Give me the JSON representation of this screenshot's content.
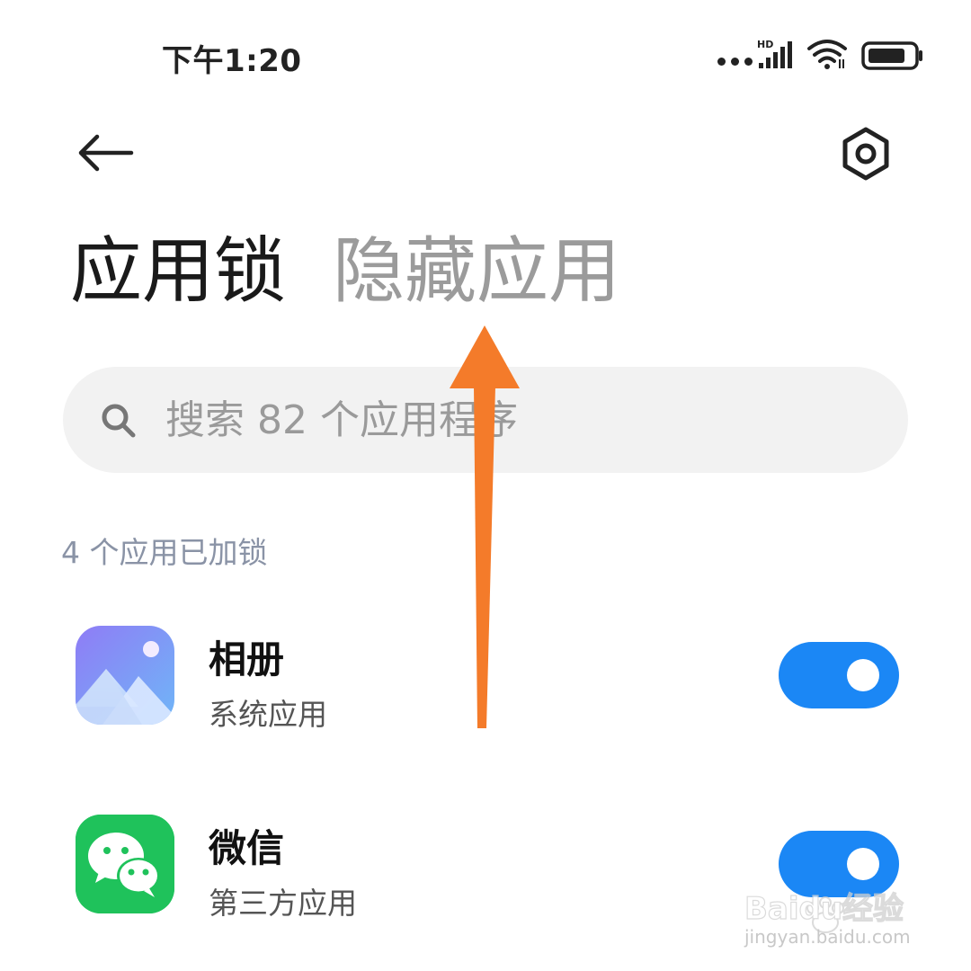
{
  "status_bar": {
    "time": "下午1:20",
    "signal_label": "HD",
    "icons": [
      "more-dots-icon",
      "signal-icon",
      "wifi-icon",
      "battery-icon"
    ]
  },
  "header": {
    "back_icon": "back-arrow-icon",
    "settings_icon": "settings-hex-icon"
  },
  "tabs": [
    {
      "label": "应用锁",
      "active": true
    },
    {
      "label": "隐藏应用",
      "active": false
    }
  ],
  "search": {
    "placeholder": "搜索 82 个应用程序",
    "value": ""
  },
  "section": {
    "title": "4 个应用已加锁"
  },
  "apps": [
    {
      "name": "相册",
      "type": "系统应用",
      "icon": "gallery-icon",
      "locked": true
    },
    {
      "name": "微信",
      "type": "第三方应用",
      "icon": "wechat-icon",
      "locked": true
    }
  ],
  "colors": {
    "accent": "#1b87f5",
    "annotation_arrow": "#f47b2a",
    "tab_inactive": "#9b9b9b",
    "section_title": "#8a93a6",
    "search_bg": "#f2f2f2",
    "wechat_green": "#1fc25b"
  },
  "watermark": {
    "brand": "Baidu经验",
    "url": "jingyan.baidu.com"
  }
}
